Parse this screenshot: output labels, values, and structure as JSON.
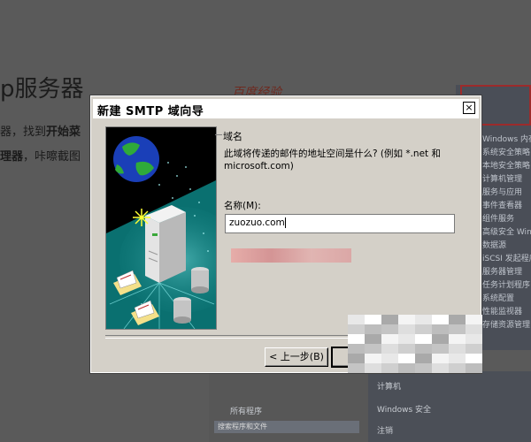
{
  "background": {
    "heading": "p服务器",
    "line1_prefix": "器，找到",
    "line1_bold": "开始菜",
    "line2_bold": "理器",
    "line2_rest": "，咔嚓截图",
    "handwriting": "百度经验",
    "right_panel_items": [
      "Windows 内存",
      "系统安全策略",
      "本地安全策略",
      "计算机管理",
      "服务与应用",
      "事件查看器",
      "组件服务",
      "高级安全 Win",
      "数据源",
      "iSCSI 发起程序",
      "服务器管理",
      "任务计划程序",
      "系统配置",
      "性能监视器",
      "存储资源管理"
    ],
    "start_menu": {
      "all_programs": "所有程序",
      "search_placeholder": "搜索程序和文件",
      "computer": "计算机",
      "windows_security": "Windows 安全",
      "logoff": "注销"
    }
  },
  "dialog": {
    "title": "新建 SMTP 域向导",
    "close_glyph": "×",
    "section_title": "域名",
    "question": "此域将传递的邮件的地址空间是什么? (例如 *.net 和 microsoft.com)",
    "name_label": "名称(M):",
    "name_value": "zuozuo.com",
    "back_button": "< 上一步(B)",
    "next_button": ""
  },
  "colors": {
    "dialog_bg": "#d4d0c8",
    "art_bg": "#0c7d7d",
    "titlebar_bg": "#ffffff"
  }
}
